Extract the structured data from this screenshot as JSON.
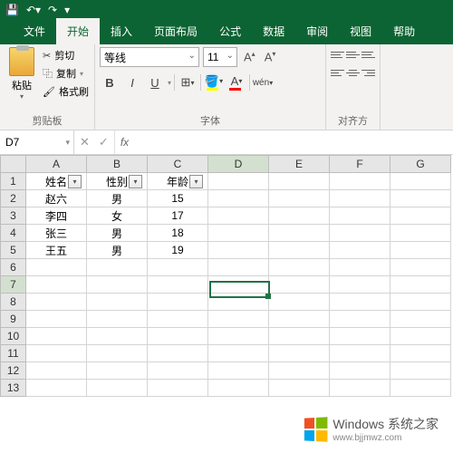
{
  "titlebar": {
    "save": "save",
    "undo": "undo",
    "redo": "redo"
  },
  "tabs": [
    "文件",
    "开始",
    "插入",
    "页面布局",
    "公式",
    "数据",
    "审阅",
    "视图",
    "帮助"
  ],
  "active_tab": 1,
  "ribbon": {
    "clipboard": {
      "paste": "粘贴",
      "cut": "剪切",
      "copy": "复制",
      "format_painter": "格式刷",
      "label": "剪贴板"
    },
    "font": {
      "name": "等线",
      "size": "11",
      "label": "字体",
      "bold": "B",
      "italic": "I",
      "underline": "U"
    },
    "align": {
      "label": "对齐方"
    }
  },
  "namebox": {
    "ref": "D7",
    "fx": "fx"
  },
  "columns": [
    "A",
    "B",
    "C",
    "D",
    "E",
    "F",
    "G"
  ],
  "row_count": 13,
  "headers": [
    "姓名",
    "性别",
    "年龄"
  ],
  "rows": [
    {
      "name": "赵六",
      "gender": "男",
      "age": "15"
    },
    {
      "name": "李四",
      "gender": "女",
      "age": "17"
    },
    {
      "name": "张三",
      "gender": "男",
      "age": "18"
    },
    {
      "name": "王五",
      "gender": "男",
      "age": "19"
    }
  ],
  "selected": {
    "col": "D",
    "row": 7
  },
  "watermark": {
    "brand": "Windows",
    "sub": "系统之家",
    "url": "www.bjjmwz.com"
  }
}
